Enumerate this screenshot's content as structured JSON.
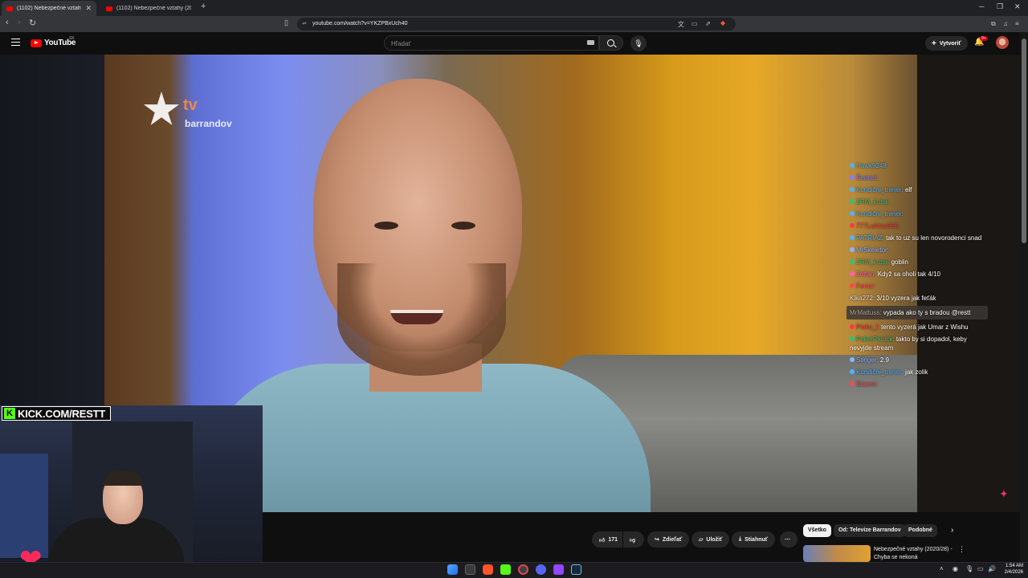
{
  "browser": {
    "tabs": [
      {
        "label": "(1102) Nebezpečné vztahy (2020/28) - Chyba se nekoná",
        "active": true
      },
      {
        "label": "(1102) Nebezpečné vztahy (2020/28) - Chyba se nekoná",
        "active": false
      }
    ],
    "url": "youtube.com/watch?v=YKZPBxUch40"
  },
  "youtube": {
    "logo_text": "YouTube",
    "region": "SK",
    "search_placeholder": "Hľadať",
    "create_label": "Vytvoriť",
    "notifications_badge": "9+"
  },
  "video": {
    "channel_watermark": {
      "tv": "tv",
      "name": "barrandov"
    }
  },
  "chat": {
    "messages": [
      {
        "user": "Hawk9248",
        "text": "",
        "user_color": "#4ab4ff",
        "badge_color": "#4ab4ff",
        "highlight": false
      },
      {
        "user": "Šeanet:",
        "text": "",
        "user_color": "#8a7cff",
        "badge_color": "#8a7cff",
        "highlight": false
      },
      {
        "user": "Kundiční_trener:",
        "text": "elf",
        "user_color": "#4ab4ff",
        "badge_color": "#4ab4ff",
        "highlight": false
      },
      {
        "user": "ZRM_kuba:",
        "text": "",
        "user_color": "#2ec27e",
        "badge_color": "#2ec27e",
        "highlight": false
      },
      {
        "user": "Kundiční_trener:",
        "text": "",
        "user_color": "#4ab4ff",
        "badge_color": "#4ab4ff",
        "highlight": false
      },
      {
        "user": "777Lukitos666:",
        "text": "",
        "user_color": "#ff3b3b",
        "badge_color": "#ff3b3b",
        "highlight": false
      },
      {
        "user": "PATRIAZ:",
        "text": "tak to uz su len novorodenci snad",
        "user_color": "#4ab4ff",
        "badge_color": "#4ab4ff",
        "highlight": false
      },
      {
        "user": "MrSkeletor:",
        "text": "",
        "user_color": "#8ab4ff",
        "badge_color": "#8ab4ff",
        "highlight": false
      },
      {
        "user": "ZRM_kuba:",
        "text": "goblin",
        "user_color": "#2ec27e",
        "badge_color": "#2ec27e",
        "highlight": false
      },
      {
        "user": "Zoltan:",
        "text": "Když sa oholi tak 4/10",
        "user_color": "#ff5fa8",
        "badge_color": "#ff5fa8",
        "highlight": false
      },
      {
        "user": "Ferror:",
        "text": "",
        "user_color": "#ff4a4a",
        "badge_color": "#ff4a4a",
        "highlight": false
      },
      {
        "user": "Kika272:",
        "text": "3/10 vyzera jak feťák",
        "user_color": "#e0e0e0",
        "badge_color": "",
        "highlight": false
      },
      {
        "user": "MrMattuss:",
        "text": "vypada ako ty s bradou @restt",
        "user_color": "#b0a8a0",
        "badge_color": "",
        "highlight": true
      },
      {
        "user": "Pieko_I:",
        "text": "tento vyzerá jak Umar z Wishu",
        "user_color": "#ff3b3b",
        "badge_color": "#ff3b3b",
        "highlight": false
      },
      {
        "user": "PokerPatrick:",
        "text": "takto by si dopadol, keby nevyjde stream",
        "user_color": "#2ec27e",
        "badge_color": "#2ec27e",
        "highlight": false
      },
      {
        "user": "Stinger:",
        "text": "2.9",
        "user_color": "#8ab4ff",
        "badge_color": "#8ab4ff",
        "highlight": false
      },
      {
        "user": "Kundiční_trener:",
        "text": "jak zolik",
        "user_color": "#4ab4ff",
        "badge_color": "#4ab4ff",
        "highlight": false
      },
      {
        "user": "Stacee:",
        "text": "",
        "user_color": "#ff4a4a",
        "badge_color": "#ff4a4a",
        "highlight": false
      }
    ]
  },
  "stream_overlay": {
    "kick_banner": "KICK.COM/RESTT",
    "kick_k": "K"
  },
  "actions": {
    "likes": "171",
    "share": "Zdieľať",
    "save": "Uložiť",
    "download": "Stiahnuť"
  },
  "chips": [
    "Všetko",
    "Od: Televize Barrandov",
    "Podobné"
  ],
  "recommendation": {
    "title": "Nebezpečné vztahy (2020/28) - Chyba se nekoná"
  },
  "taskbar": {
    "time": "1:54 AM",
    "date": "2/4/2026"
  },
  "colors": {
    "youtube_red": "#ff0000",
    "kick_green": "#53fc18",
    "bg": "#0f0f0f"
  }
}
